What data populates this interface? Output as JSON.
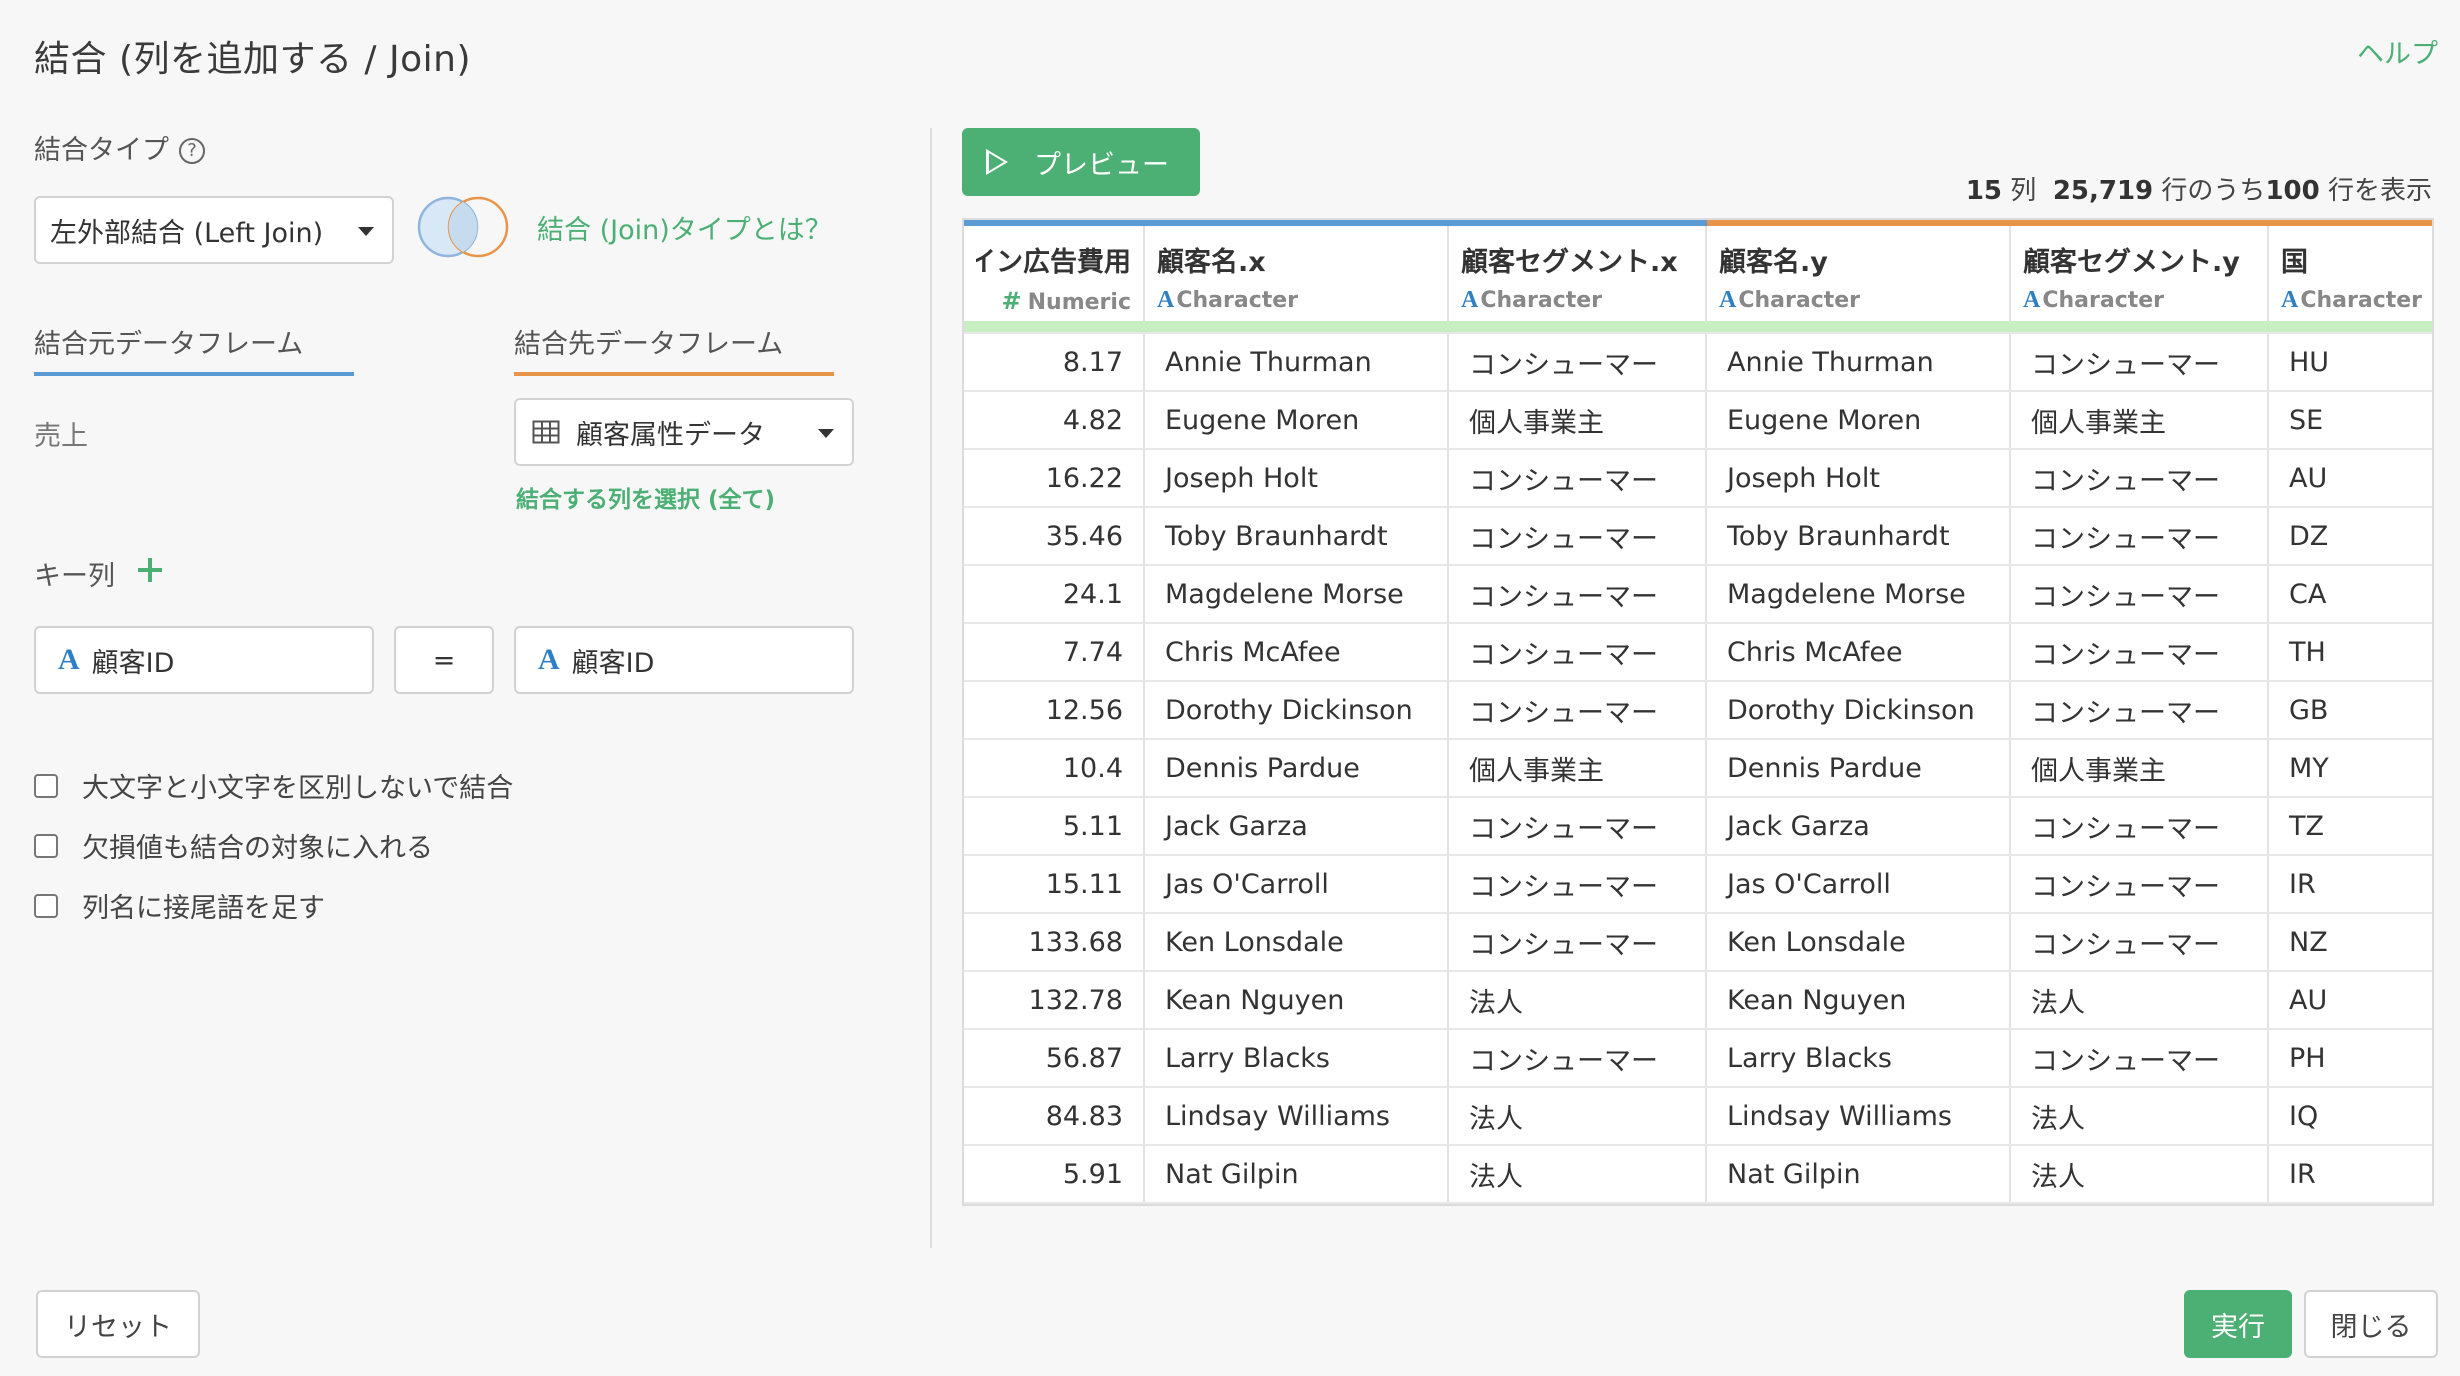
{
  "dialog": {
    "title": "結合 (列を追加する / Join)",
    "help_label": "ヘルプ"
  },
  "join_type": {
    "label": "結合タイプ",
    "help_icon": "question-circle-icon",
    "selected": "左外部結合 (Left Join)",
    "venn_icon": "venn-diagram-icon",
    "info_link": "結合 (Join)タイプとは？"
  },
  "source": {
    "tab_label": "結合元データフレーム",
    "value": "売上",
    "tab_color": "#5b9bd5"
  },
  "target": {
    "tab_label": "結合先データフレーム",
    "selected": "顧客属性データ",
    "table_icon": "table-grid-icon",
    "select_columns_link": "結合する列を選択 (全て)",
    "tab_color": "#e8954a"
  },
  "keys": {
    "label": "キー列",
    "add_icon": "plus-icon",
    "left_type": "A",
    "left_column": "顧客ID",
    "operator": "=",
    "right_type": "A",
    "right_column": "顧客ID"
  },
  "options": [
    {
      "label": "大文字と小文字を区別しないで結合",
      "checked": false
    },
    {
      "label": "欠損値も結合の対象に入れる",
      "checked": false
    },
    {
      "label": "列名に接尾語を足す",
      "checked": false
    }
  ],
  "preview": {
    "button_label": "プレビュー",
    "play_icon": "play-icon",
    "stats": {
      "cols_num": "15",
      "cols_unit": "列",
      "rows_num": "25,719",
      "rows_unit": "行のうち",
      "shown_num": "100",
      "shown_unit": "行を表示"
    }
  },
  "table": {
    "columns": [
      {
        "name": "イン広告費用",
        "type_symbol": "#",
        "type": "Numeric",
        "accent": "#5b9bd5"
      },
      {
        "name": "顧客名.x",
        "type_symbol": "A",
        "type": "Character",
        "accent": "#5b9bd5"
      },
      {
        "name": "顧客セグメント.x",
        "type_symbol": "A",
        "type": "Character",
        "accent": "#5b9bd5"
      },
      {
        "name": "顧客名.y",
        "type_symbol": "A",
        "type": "Character",
        "accent": "#e8954a"
      },
      {
        "name": "顧客セグメント.y",
        "type_symbol": "A",
        "type": "Character",
        "accent": "#e8954a"
      },
      {
        "name": "国",
        "type_symbol": "A",
        "type": "Character",
        "accent": "#e8954a"
      }
    ],
    "rows": [
      [
        "8.17",
        "Annie Thurman",
        "コンシューマー",
        "Annie Thurman",
        "コンシューマー",
        "HU"
      ],
      [
        "4.82",
        "Eugene Moren",
        "個人事業主",
        "Eugene Moren",
        "個人事業主",
        "SE"
      ],
      [
        "16.22",
        "Joseph Holt",
        "コンシューマー",
        "Joseph Holt",
        "コンシューマー",
        "AU"
      ],
      [
        "35.46",
        "Toby Braunhardt",
        "コンシューマー",
        "Toby Braunhardt",
        "コンシューマー",
        "DZ"
      ],
      [
        "24.1",
        "Magdelene Morse",
        "コンシューマー",
        "Magdelene Morse",
        "コンシューマー",
        "CA"
      ],
      [
        "7.74",
        "Chris McAfee",
        "コンシューマー",
        "Chris McAfee",
        "コンシューマー",
        "TH"
      ],
      [
        "12.56",
        "Dorothy Dickinson",
        "コンシューマー",
        "Dorothy Dickinson",
        "コンシューマー",
        "GB"
      ],
      [
        "10.4",
        "Dennis Pardue",
        "個人事業主",
        "Dennis Pardue",
        "個人事業主",
        "MY"
      ],
      [
        "5.11",
        "Jack Garza",
        "コンシューマー",
        "Jack Garza",
        "コンシューマー",
        "TZ"
      ],
      [
        "15.11",
        "Jas O'Carroll",
        "コンシューマー",
        "Jas O'Carroll",
        "コンシューマー",
        "IR"
      ],
      [
        "133.68",
        "Ken Lonsdale",
        "コンシューマー",
        "Ken Lonsdale",
        "コンシューマー",
        "NZ"
      ],
      [
        "132.78",
        "Kean Nguyen",
        "法人",
        "Kean Nguyen",
        "法人",
        "AU"
      ],
      [
        "56.87",
        "Larry Blacks",
        "コンシューマー",
        "Larry Blacks",
        "コンシューマー",
        "PH"
      ],
      [
        "84.83",
        "Lindsay Williams",
        "法人",
        "Lindsay Williams",
        "法人",
        "IQ"
      ],
      [
        "5.91",
        "Nat Gilpin",
        "法人",
        "Nat Gilpin",
        "法人",
        "IR"
      ]
    ]
  },
  "footer": {
    "reset_label": "リセット",
    "run_label": "実行",
    "close_label": "閉じる",
    "accent_color": "#4caf74"
  }
}
